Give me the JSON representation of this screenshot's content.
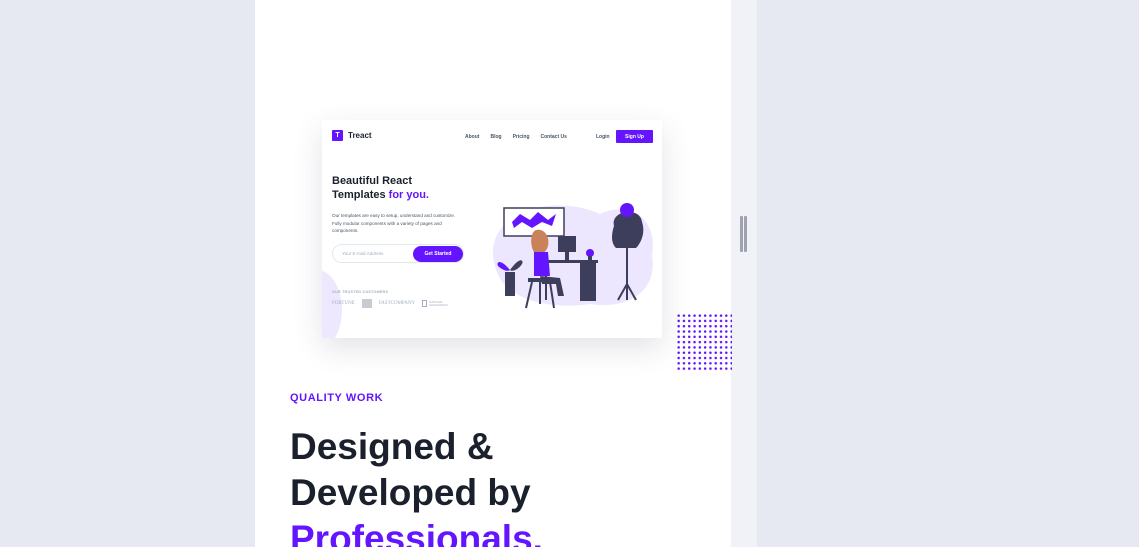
{
  "colors": {
    "primary": "#6415ff",
    "text_dark": "#1a202c",
    "text_gray": "#4a5568",
    "page_bg": "#e6e8f2"
  },
  "mock": {
    "logo": {
      "mark": "T",
      "name": "Treact"
    },
    "nav": [
      "About",
      "Blog",
      "Pricing",
      "Contact Us"
    ],
    "login": "Login",
    "signup": "Sign Up",
    "hero": {
      "title_line1": "Beautiful React",
      "title_line2_part1": "Templates ",
      "title_accent": "for you.",
      "description": "Our templates are easy to setup, understand and customize. Fully modular components with a variety of pages and components.",
      "email_placeholder": "Your E-mail Address",
      "cta": "Get Started",
      "trusted_label": "OUR TRUSTED CUSTOMERS",
      "customers": [
        "FORTUNE",
        "FASTCOMPANY",
        "NATIONAL GEOGRAPHIC"
      ]
    }
  },
  "section": {
    "subheading": "QUALITY WORK",
    "heading_line1": "Designed &",
    "heading_line2": "Developed by",
    "heading_accent": "Professionals."
  },
  "icons": {
    "logo_mark": "treact-logo-icon",
    "illustration": "desk-worker-illustration",
    "drag": "drag-handle-icon"
  }
}
